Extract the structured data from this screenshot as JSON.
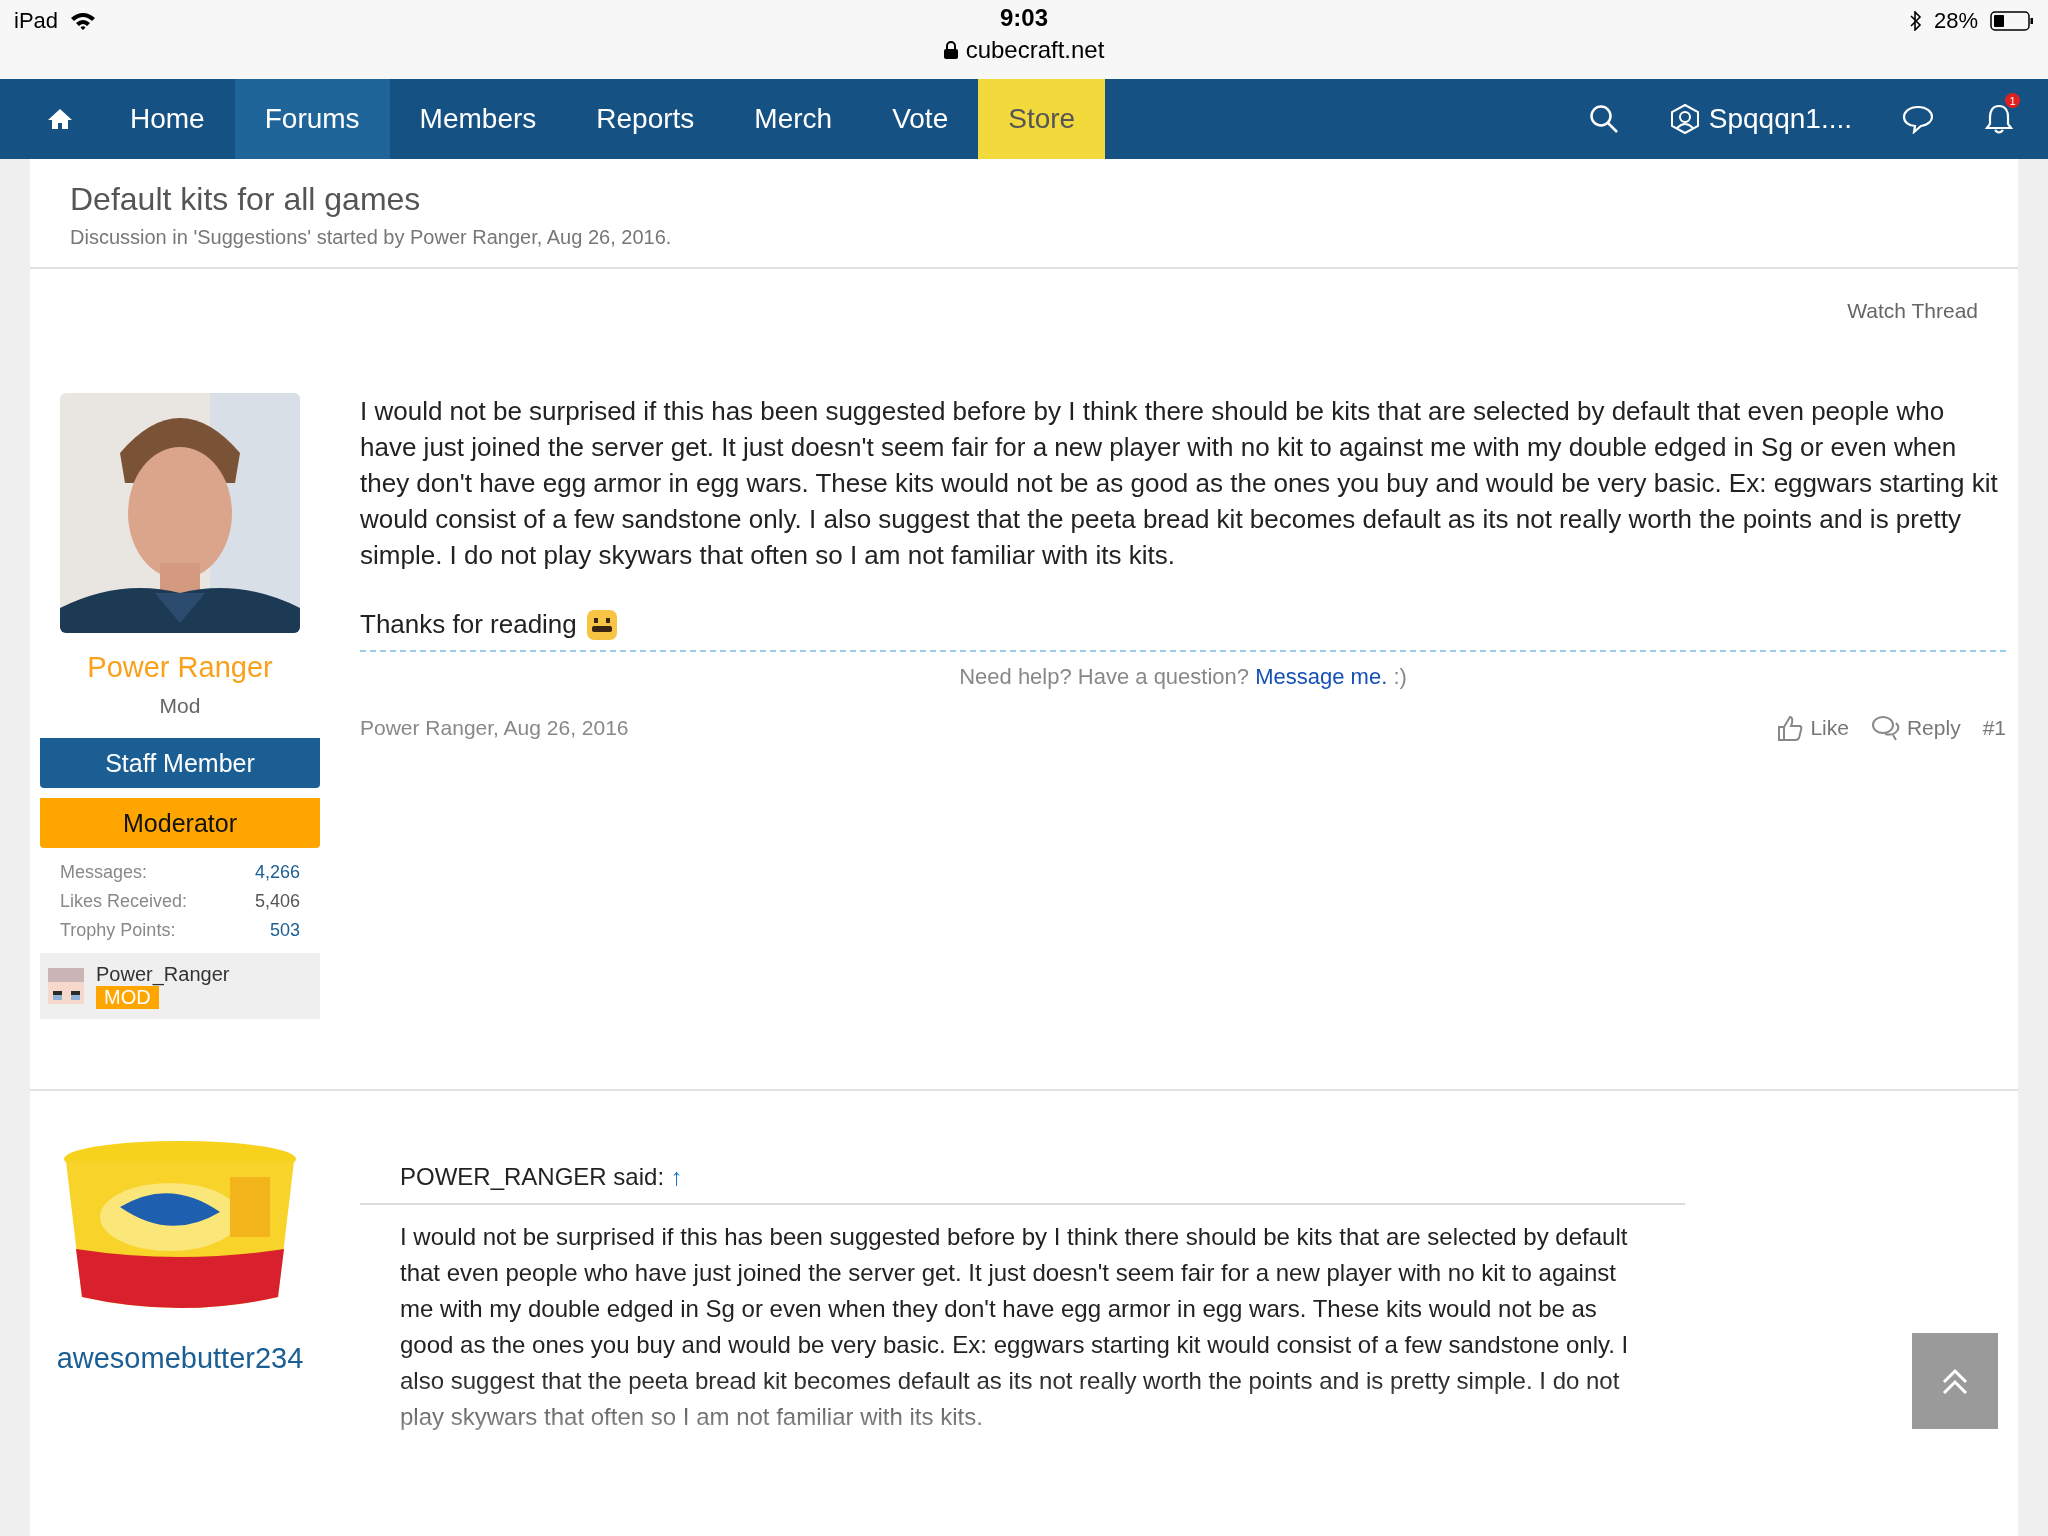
{
  "status_bar": {
    "device": "iPad",
    "time": "9:03",
    "url": "cubecraft.net",
    "battery": "28%"
  },
  "nav": {
    "items": [
      {
        "label": "Home",
        "kind": "link",
        "selected": false
      },
      {
        "label": "Forums",
        "kind": "link",
        "selected": true
      },
      {
        "label": "Members",
        "kind": "link",
        "selected": false
      },
      {
        "label": "Reports",
        "kind": "link",
        "selected": false
      },
      {
        "label": "Merch",
        "kind": "link",
        "selected": false
      },
      {
        "label": "Vote",
        "kind": "link",
        "selected": false
      },
      {
        "label": "Store",
        "kind": "highlight",
        "selected": false
      }
    ],
    "user": "Spqqqn1....",
    "notification_count": "1"
  },
  "thread": {
    "title": "Default kits for all games",
    "subtitle": "Discussion in 'Suggestions' started by Power Ranger, Aug 26, 2016.",
    "watch": "Watch Thread"
  },
  "posts": [
    {
      "author": "Power Ranger",
      "kind": "staff",
      "user_title": "Mod",
      "banners": [
        {
          "label": "Staff Member",
          "kind": "staff"
        },
        {
          "label": "Moderator",
          "kind": "moderator"
        }
      ],
      "stats": [
        {
          "label": "Messages:",
          "value": "4,266",
          "linked": true
        },
        {
          "label": "Likes Received:",
          "value": "5,406",
          "linked": false
        },
        {
          "label": "Trophy Points:",
          "value": "503",
          "linked": true
        }
      ],
      "game_profile": {
        "name": "Power_Ranger",
        "rank": "MOD"
      },
      "body": "I would not be surprised if this has been suggested before by I think there should be kits that are selected by default that even people who have just joined the server get. It just doesn't seem fair for a new player with no kit to against me with my double edged in Sg or even when they don't have egg armor in egg wars. These kits would not be as good as the ones you buy and would be very basic. Ex: eggwars starting kit would consist of a few sandstone only. I also suggest that the peeta bread kit becomes default as its not really worth the points and is pretty simple. I do not play skywars that often so I am not familiar with its kits.",
      "closing": "Thanks for reading",
      "signature": {
        "text": "Need help? Have a question?",
        "link": "Message me.",
        "tail": ":)"
      },
      "footer": {
        "meta": "Power Ranger, Aug 26, 2016",
        "like": "Like",
        "reply": "Reply",
        "number": "#1"
      }
    },
    {
      "author": "awesomebutter234",
      "kind": "member",
      "quote": {
        "source": "POWER_RANGER said:",
        "arrow": "↑",
        "text": "I would not be surprised if this has been suggested before by I think there should be kits that are selected by default that even people who have just joined the server get. It just doesn't seem fair for a new player with no kit to against me with my double edged in Sg or even when they don't have egg armor in egg wars. These kits would not be as good as the ones you buy and would be very basic. Ex: eggwars starting kit would consist of a few sandstone only. I also suggest that the peeta bread kit becomes default as its not really worth the points and is pretty simple. I do not play skywars that often so I am not familiar with its kits."
      }
    }
  ]
}
